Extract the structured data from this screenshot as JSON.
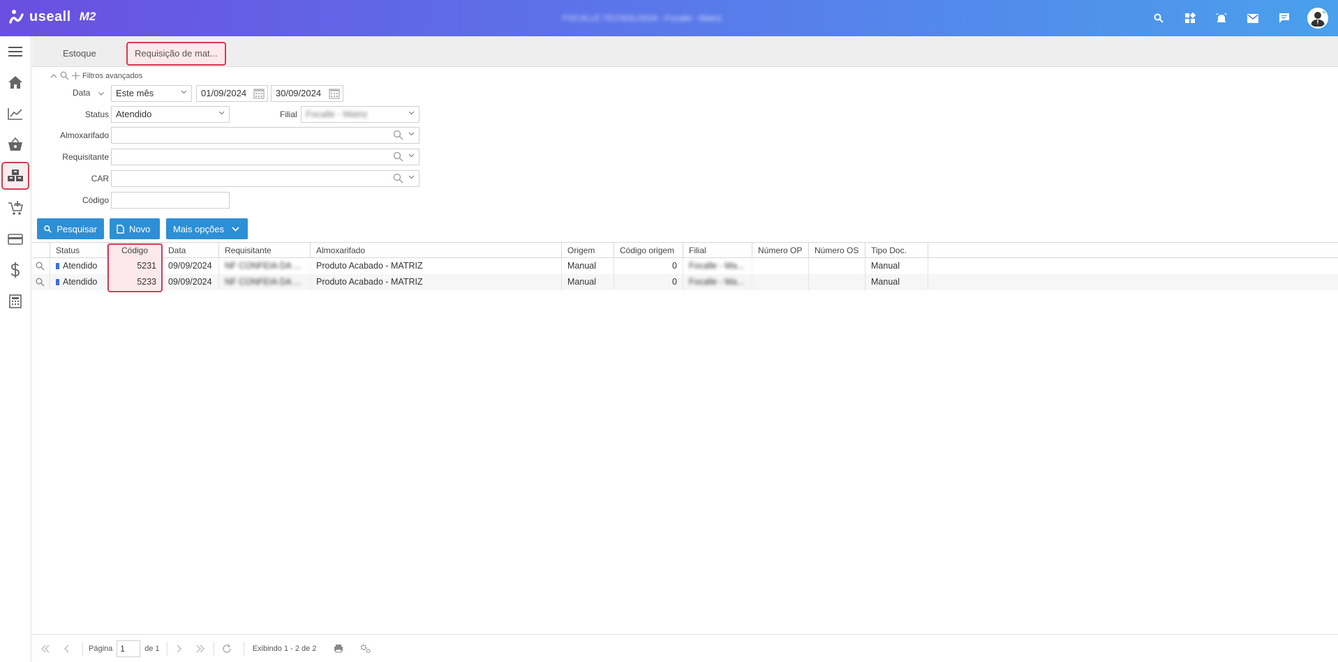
{
  "app": {
    "brand": "useall",
    "product": "M2",
    "company": "FOCALLE TECNOLOGIA - Focalle - Matriz"
  },
  "topbar": {
    "icons": [
      "search-icon",
      "apps-icon",
      "alarm-icon",
      "mail-icon",
      "chat-icon",
      "user-avatar"
    ]
  },
  "sidebar": {
    "items": [
      "menu-icon",
      "home-icon",
      "chart-icon",
      "basket-icon",
      "boxes-icon",
      "cart-add-icon",
      "card-icon",
      "dollar-icon",
      "calculator-icon"
    ],
    "active": "boxes-icon"
  },
  "tabs": [
    {
      "label": "Estoque"
    },
    {
      "label": "Requisição de mat..."
    }
  ],
  "filters": {
    "advanced_label": "Filtros avançados",
    "data_label": "Data",
    "period_value": "Este mês",
    "date_from": "01/09/2024",
    "date_to": "30/09/2024",
    "status_label": "Status",
    "status_value": "Atendido",
    "filial_label": "Filial",
    "filial_value": "Focalle - Matriz",
    "almoxarifado_label": "Almoxarifado",
    "requisitante_label": "Requisitante",
    "car_label": "CAR",
    "codigo_label": "Código"
  },
  "buttons": {
    "search": "Pesquisar",
    "new": "Novo",
    "more": "Mais opções"
  },
  "grid": {
    "columns": [
      "Status",
      "Código",
      "Data",
      "Requisitante",
      "Almoxarifado",
      "Origem",
      "Código origem",
      "Filial",
      "Número OP",
      "Número OS",
      "Tipo Doc."
    ],
    "rows": [
      {
        "status": "Atendido",
        "codigo": "5231",
        "data": "09/09/2024",
        "requisitante": "NF CONFEIA DA ...",
        "almoxarifado": "Produto Acabado - MATRIZ",
        "origem": "Manual",
        "codigo_origem": "0",
        "filial": "Focalle - Ma...",
        "numero_op": "",
        "numero_os": "",
        "tipo_doc": "Manual"
      },
      {
        "status": "Atendido",
        "codigo": "5233",
        "data": "09/09/2024",
        "requisitante": "NF CONFEIA DA ...",
        "almoxarifado": "Produto Acabado - MATRIZ",
        "origem": "Manual",
        "codigo_origem": "0",
        "filial": "Focalle - Ma...",
        "numero_op": "",
        "numero_os": "",
        "tipo_doc": "Manual"
      }
    ]
  },
  "footer": {
    "page_label": "Página",
    "page_value": "1",
    "of_label": "de 1",
    "showing": "Exibindo 1 - 2 de 2"
  },
  "colors": {
    "accent": "#2d8fd6",
    "highlight": "#d83a52",
    "status_dot": "#3d6fd8"
  }
}
